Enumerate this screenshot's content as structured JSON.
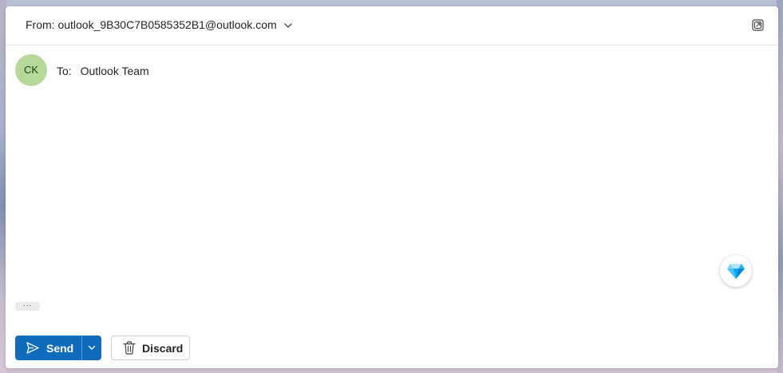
{
  "header": {
    "from_label": "From:",
    "from_address": "outlook_9B30C7B0585352B1@outlook.com"
  },
  "recipient": {
    "avatar_initials": "CK",
    "to_label": "To:",
    "to_name": "Outlook Team"
  },
  "toolbar": {
    "more_label": "...",
    "send_label": "Send",
    "discard_label": "Discard"
  },
  "icons": {
    "from_dropdown": "chevron-down-icon",
    "popout": "popout-icon",
    "premium": "diamond-icon",
    "send": "send-icon",
    "send_options": "chevron-down-icon",
    "discard": "trash-icon"
  },
  "colors": {
    "accent": "#0f6cbd",
    "avatar_bg": "#b6d99a",
    "diamond": "#4fc3f7"
  }
}
